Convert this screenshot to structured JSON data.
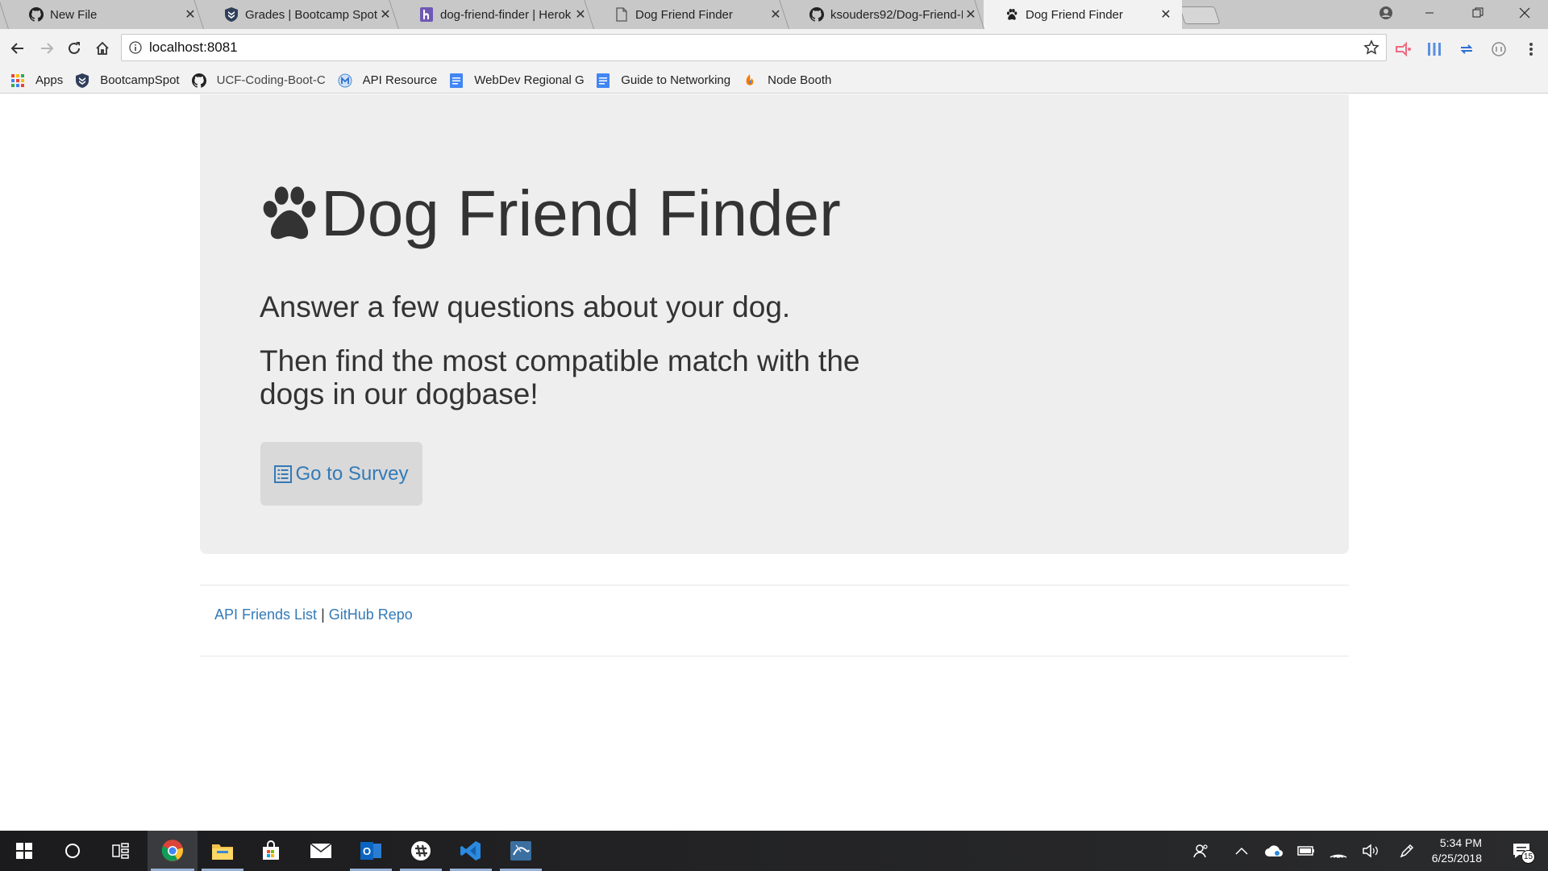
{
  "browser": {
    "tabs": [
      {
        "label": "New File",
        "icon": "github-icon"
      },
      {
        "label": "Grades | Bootcamp Spot",
        "icon": "bootcampspot-icon"
      },
      {
        "label": "dog-friend-finder | Herok",
        "icon": "heroku-icon"
      },
      {
        "label": "Dog Friend Finder",
        "icon": "page-icon"
      },
      {
        "label": "ksouders92/Dog-Friend-F",
        "icon": "github-icon"
      },
      {
        "label": "Dog Friend Finder",
        "icon": "paw-icon",
        "active": true
      }
    ],
    "address": "localhost:8081",
    "bookmarks": [
      {
        "label": "Apps",
        "icon": "apps-grid-icon"
      },
      {
        "label": "BootcampSpot",
        "icon": "bootcampspot-icon"
      },
      {
        "label": "UCF-Coding-Boot-C",
        "icon": "github-icon"
      },
      {
        "label": "API Resource",
        "icon": "api-resource-icon"
      },
      {
        "label": "WebDev Regional Gu",
        "icon": "google-doc-icon"
      },
      {
        "label": "Guide to Networking",
        "icon": "google-doc-icon"
      },
      {
        "label": "Node Booth",
        "icon": "node-booth-icon"
      }
    ]
  },
  "page": {
    "title": "Dog Friend Finder",
    "lead1": "Answer a few questions about your dog.",
    "lead2": "Then find the most compatible match with the dogs in our dogbase!",
    "survey_button": "Go to Survey",
    "footer": {
      "api_link": "API Friends List",
      "separator": "|",
      "github_link": "GitHub Repo"
    }
  },
  "taskbar": {
    "time": "5:34 PM",
    "date": "6/25/2018",
    "notification_count": "15"
  },
  "colors": {
    "link": "#337ab7",
    "jumbotron": "#eeeeee",
    "button": "#d9d9d9"
  }
}
